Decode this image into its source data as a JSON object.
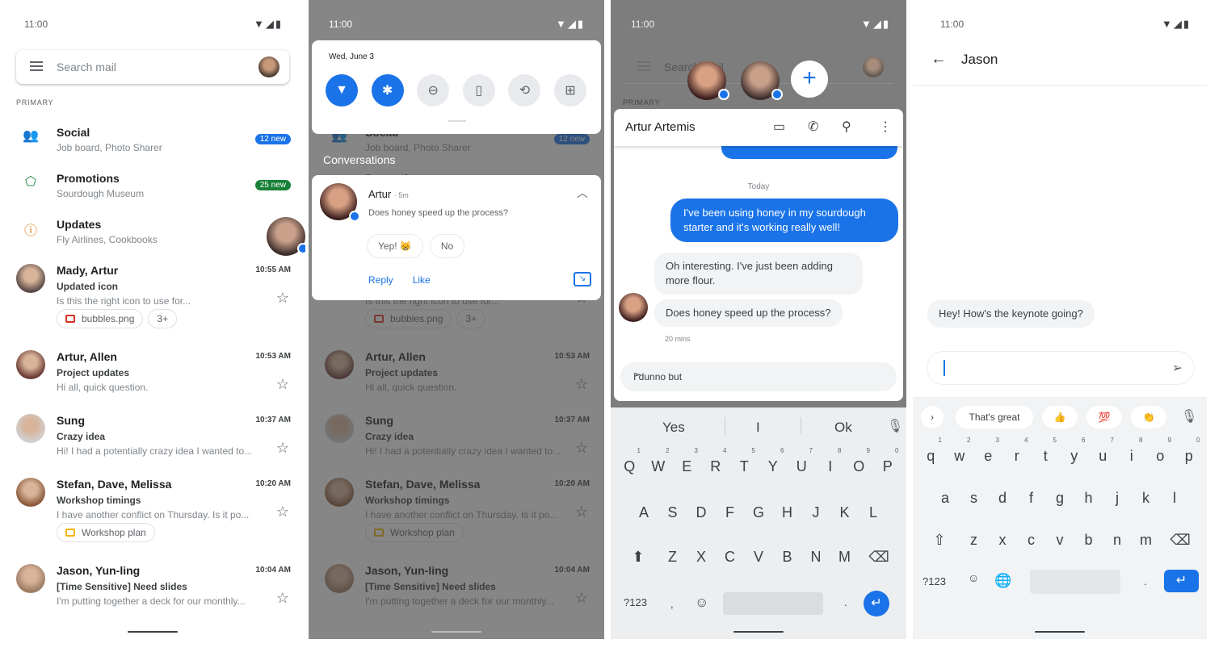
{
  "status": {
    "time": "11:00",
    "icons": "▼◢▮"
  },
  "gmail": {
    "search_placeholder": "Search mail",
    "section": "PRIMARY",
    "categories": [
      {
        "title": "Social",
        "subtitle": "Job board, Photo Sharer",
        "badge": "12 new",
        "color": "#1a73e8",
        "icon": "people-icon",
        "glyph": "👥"
      },
      {
        "title": "Promotions",
        "subtitle": "Sourdough Museum",
        "badge": "25 new",
        "color": "#188038",
        "icon": "tag-icon",
        "glyph": "⬠"
      },
      {
        "title": "Updates",
        "subtitle": "Fly Airlines, Cookbooks",
        "badge": "",
        "color": "#e37400",
        "icon": "info-icon",
        "glyph": "ⓘ"
      }
    ],
    "emails": [
      {
        "sender": "Mady, Artur",
        "time": "10:55 AM",
        "subject": "Updated icon",
        "snippet": "Is this the right icon to use for...",
        "avatar": "#5a4a48",
        "chips": [
          {
            "label": "bubbles.png",
            "color": "#d93025",
            "icon": "image-file-icon"
          },
          {
            "label": "3+"
          }
        ]
      },
      {
        "sender": "Artur, Allen",
        "time": "10:53 AM",
        "subject": "Project updates",
        "snippet": "Hi all, quick question.",
        "avatar": "#6b3b35"
      },
      {
        "sender": "Sung",
        "time": "10:37 AM",
        "subject": "Crazy idea",
        "snippet": "Hi! I had a potentially crazy idea I wanted to...",
        "avatar": "#d0d0d0"
      },
      {
        "sender": "Stefan, Dave, Melissa",
        "time": "10:20 AM",
        "subject": "Workshop timings",
        "snippet": "I have another conflict on Thursday. Is it po...",
        "avatar": "#8a5a3a",
        "chips": [
          {
            "label": "Workshop plan",
            "color": "#f4b400",
            "icon": "slides-icon"
          }
        ]
      },
      {
        "sender": "Jason, Yun-ling",
        "time": "10:04 AM",
        "subject": "[Time Sensitive] Need slides",
        "snippet": "I'm putting together a deck for our monthly...",
        "avatar": "#9b7b62"
      }
    ]
  },
  "quick_settings": {
    "date": "Wed, June 3",
    "tiles": [
      {
        "icon": "wifi-icon",
        "glyph": "▼",
        "active": true
      },
      {
        "icon": "bluetooth-icon",
        "glyph": "✱",
        "active": true
      },
      {
        "icon": "do-not-disturb-icon",
        "glyph": "⊖",
        "active": false
      },
      {
        "icon": "flashlight-icon",
        "glyph": "▯",
        "active": false
      },
      {
        "icon": "auto-rotate-icon",
        "glyph": "⟲",
        "active": false
      },
      {
        "icon": "battery-saver-icon",
        "glyph": "⊞",
        "active": false
      }
    ]
  },
  "notification": {
    "section": "Conversations",
    "sender": "Artur",
    "age": "· 5m",
    "message": "Does honey speed up the process?",
    "smart_replies": [
      "Yep! 😸",
      "No"
    ],
    "actions": [
      "Reply",
      "Like"
    ]
  },
  "chat": {
    "contact": "Artur Artemis",
    "date_divider": "Today",
    "outgoing": "I've been using honey in my sourdough starter and it's working really well!",
    "incoming": [
      "Oh interesting. I've just been adding more flour.",
      "Does honey speed up the process?"
    ],
    "timestamp": "20 mins",
    "draft": "I dunno but"
  },
  "keyboard_caps": {
    "suggestions": [
      "Yes",
      "I",
      "Ok"
    ],
    "numbers": [
      "1",
      "2",
      "3",
      "4",
      "5",
      "6",
      "7",
      "8",
      "9",
      "0"
    ],
    "rows": [
      [
        "Q",
        "W",
        "E",
        "R",
        "T",
        "Y",
        "U",
        "I",
        "O",
        "P"
      ],
      [
        "A",
        "S",
        "D",
        "F",
        "G",
        "H",
        "J",
        "K",
        "L"
      ],
      [
        "Z",
        "X",
        "C",
        "V",
        "B",
        "N",
        "M"
      ]
    ],
    "symbols_label": "?123",
    "comma": ",",
    "period": "."
  },
  "conversation": {
    "contact": "Jason",
    "incoming": "Hey! How's the keynote going?",
    "suggestions": [
      "That's great",
      "👍",
      "💯",
      "👏"
    ]
  },
  "keyboard_lower": {
    "numbers": [
      "1",
      "2",
      "3",
      "4",
      "5",
      "6",
      "7",
      "8",
      "9",
      "0"
    ],
    "rows": [
      [
        "q",
        "w",
        "e",
        "r",
        "t",
        "y",
        "u",
        "i",
        "o",
        "p"
      ],
      [
        "a",
        "s",
        "d",
        "f",
        "g",
        "h",
        "j",
        "k",
        "l"
      ],
      [
        "z",
        "x",
        "c",
        "v",
        "b",
        "n",
        "m"
      ]
    ],
    "symbols_label": "?123",
    "period": "."
  }
}
